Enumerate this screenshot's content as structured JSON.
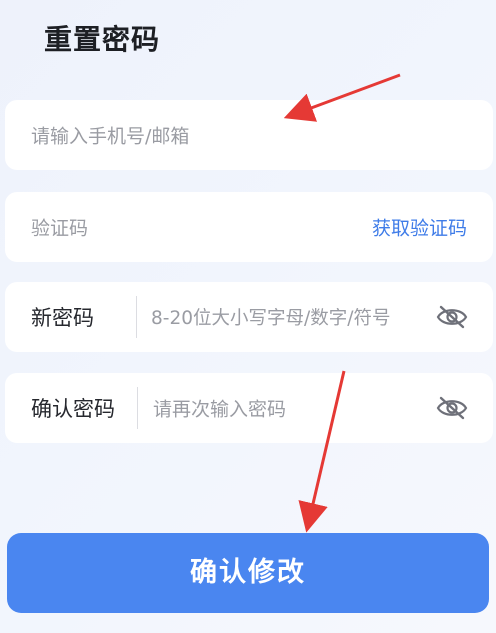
{
  "header": {
    "title": "重置密码"
  },
  "form": {
    "account": {
      "placeholder": "请输入手机号/邮箱"
    },
    "code": {
      "placeholder": "验证码",
      "action_label": "获取验证码"
    },
    "new_password": {
      "label": "新密码",
      "placeholder": "8-20位大小写字母/数字/符号",
      "visibility_icon": "eye-slash-icon"
    },
    "confirm_password": {
      "label": "确认密码",
      "placeholder": "请再次输入密码",
      "visibility_icon": "eye-slash-icon"
    }
  },
  "submit": {
    "label": "确认修改"
  },
  "colors": {
    "accent": "#4a86f0",
    "link": "#3f7ce8",
    "annotation_arrow": "#e53935"
  }
}
